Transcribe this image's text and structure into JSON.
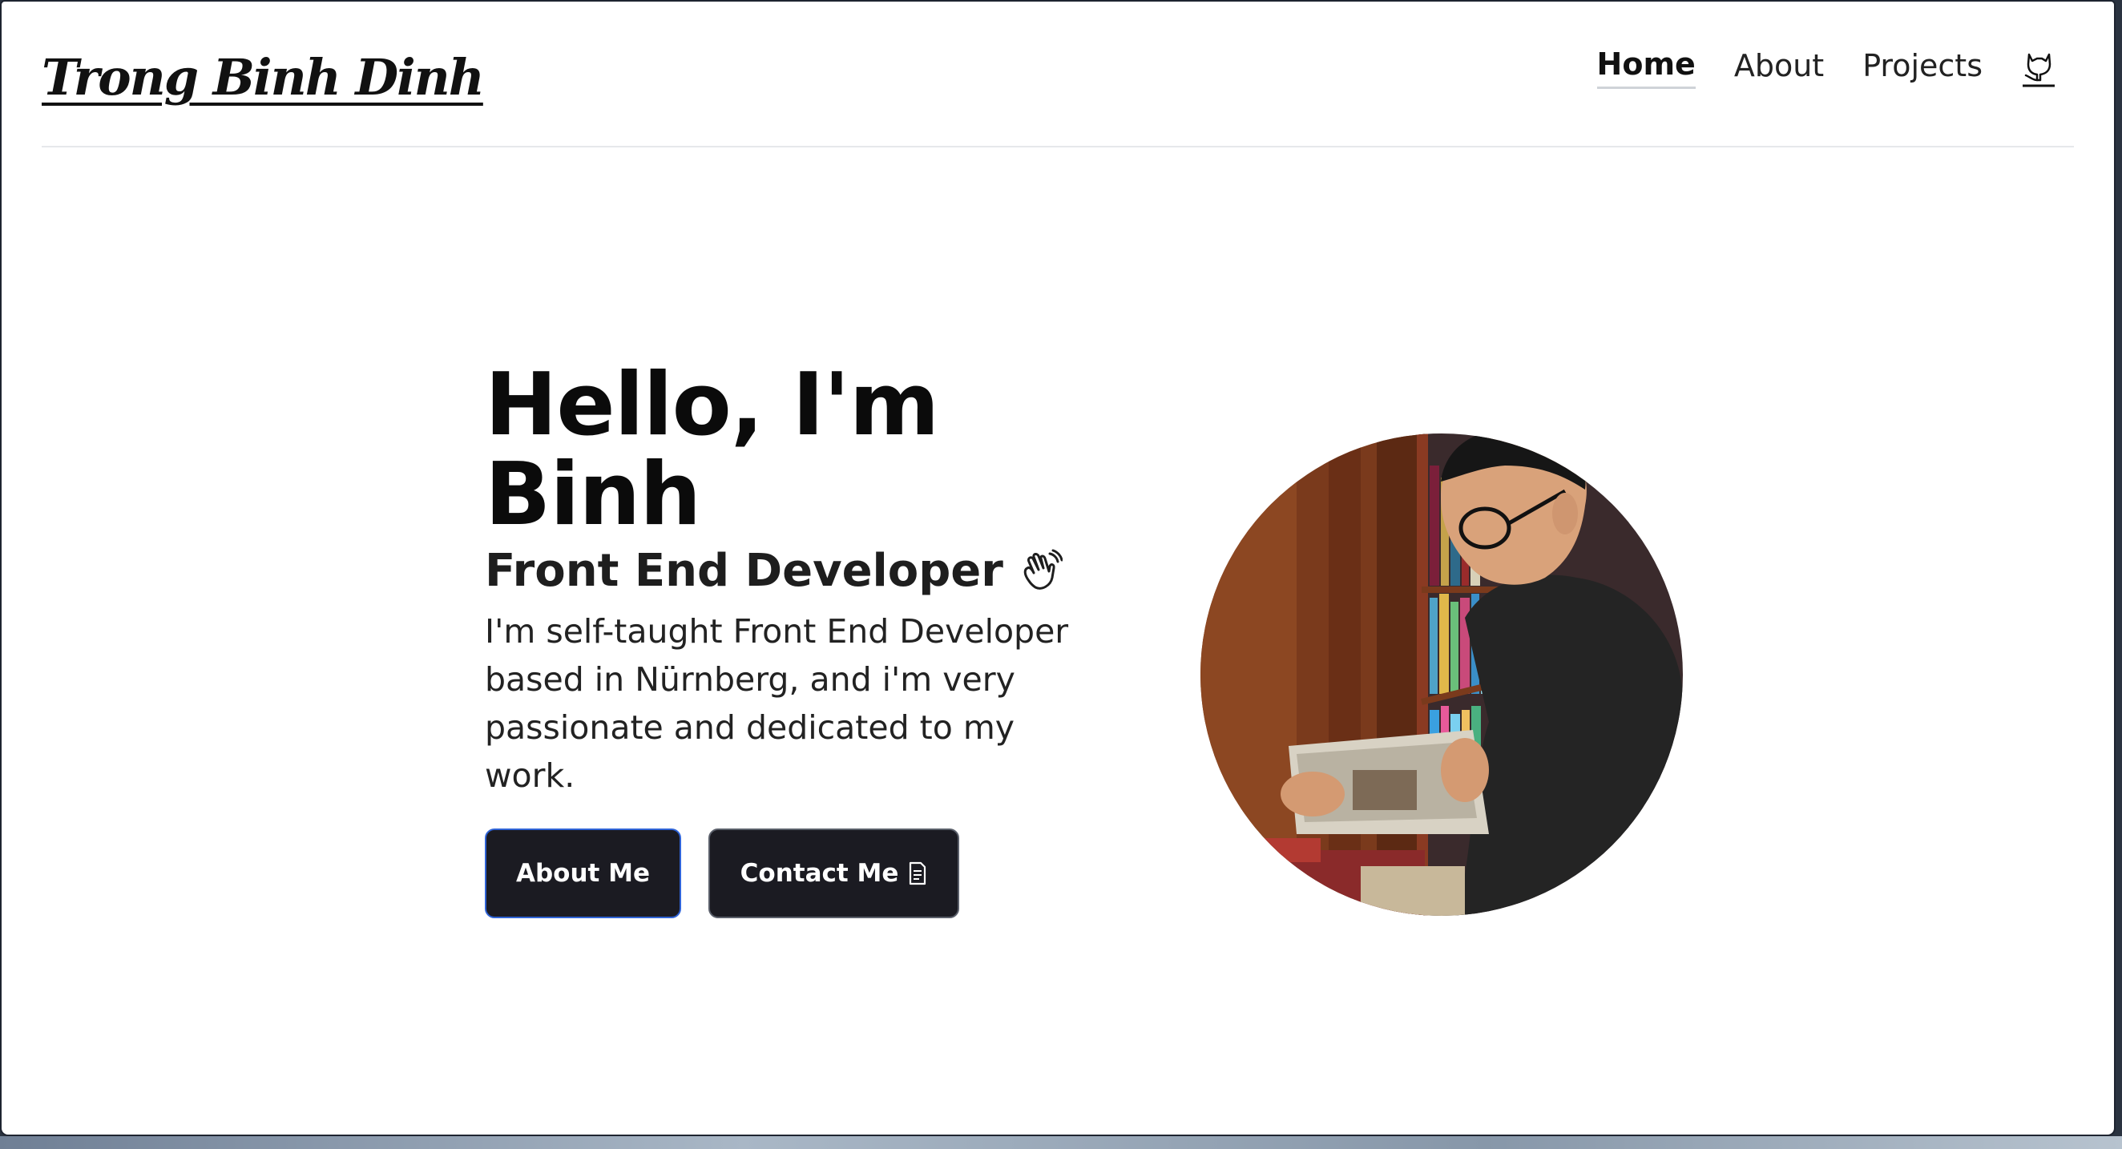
{
  "header": {
    "logo": "Trong Binh Dinh",
    "nav": [
      {
        "label": "Home",
        "active": true
      },
      {
        "label": "About",
        "active": false
      },
      {
        "label": "Projects",
        "active": false
      }
    ],
    "nav_icon": "github-cat-icon"
  },
  "hero": {
    "title_line1": "Hello, I'm",
    "title_line2": "Binh",
    "subtitle": "Front End Developer",
    "subtitle_icon": "waving-hand-icon",
    "description": "I'm self-taught Front End Developer based in Nürnberg, and i'm very passionate and dedicated to my work.",
    "primary_button": "About Me",
    "secondary_button": "Contact Me",
    "secondary_button_icon": "document-icon",
    "portrait_icon": "profile-photo"
  },
  "colors": {
    "button_bg": "#1b1b22",
    "primary_border": "#2f63d6",
    "text": "#111111"
  }
}
